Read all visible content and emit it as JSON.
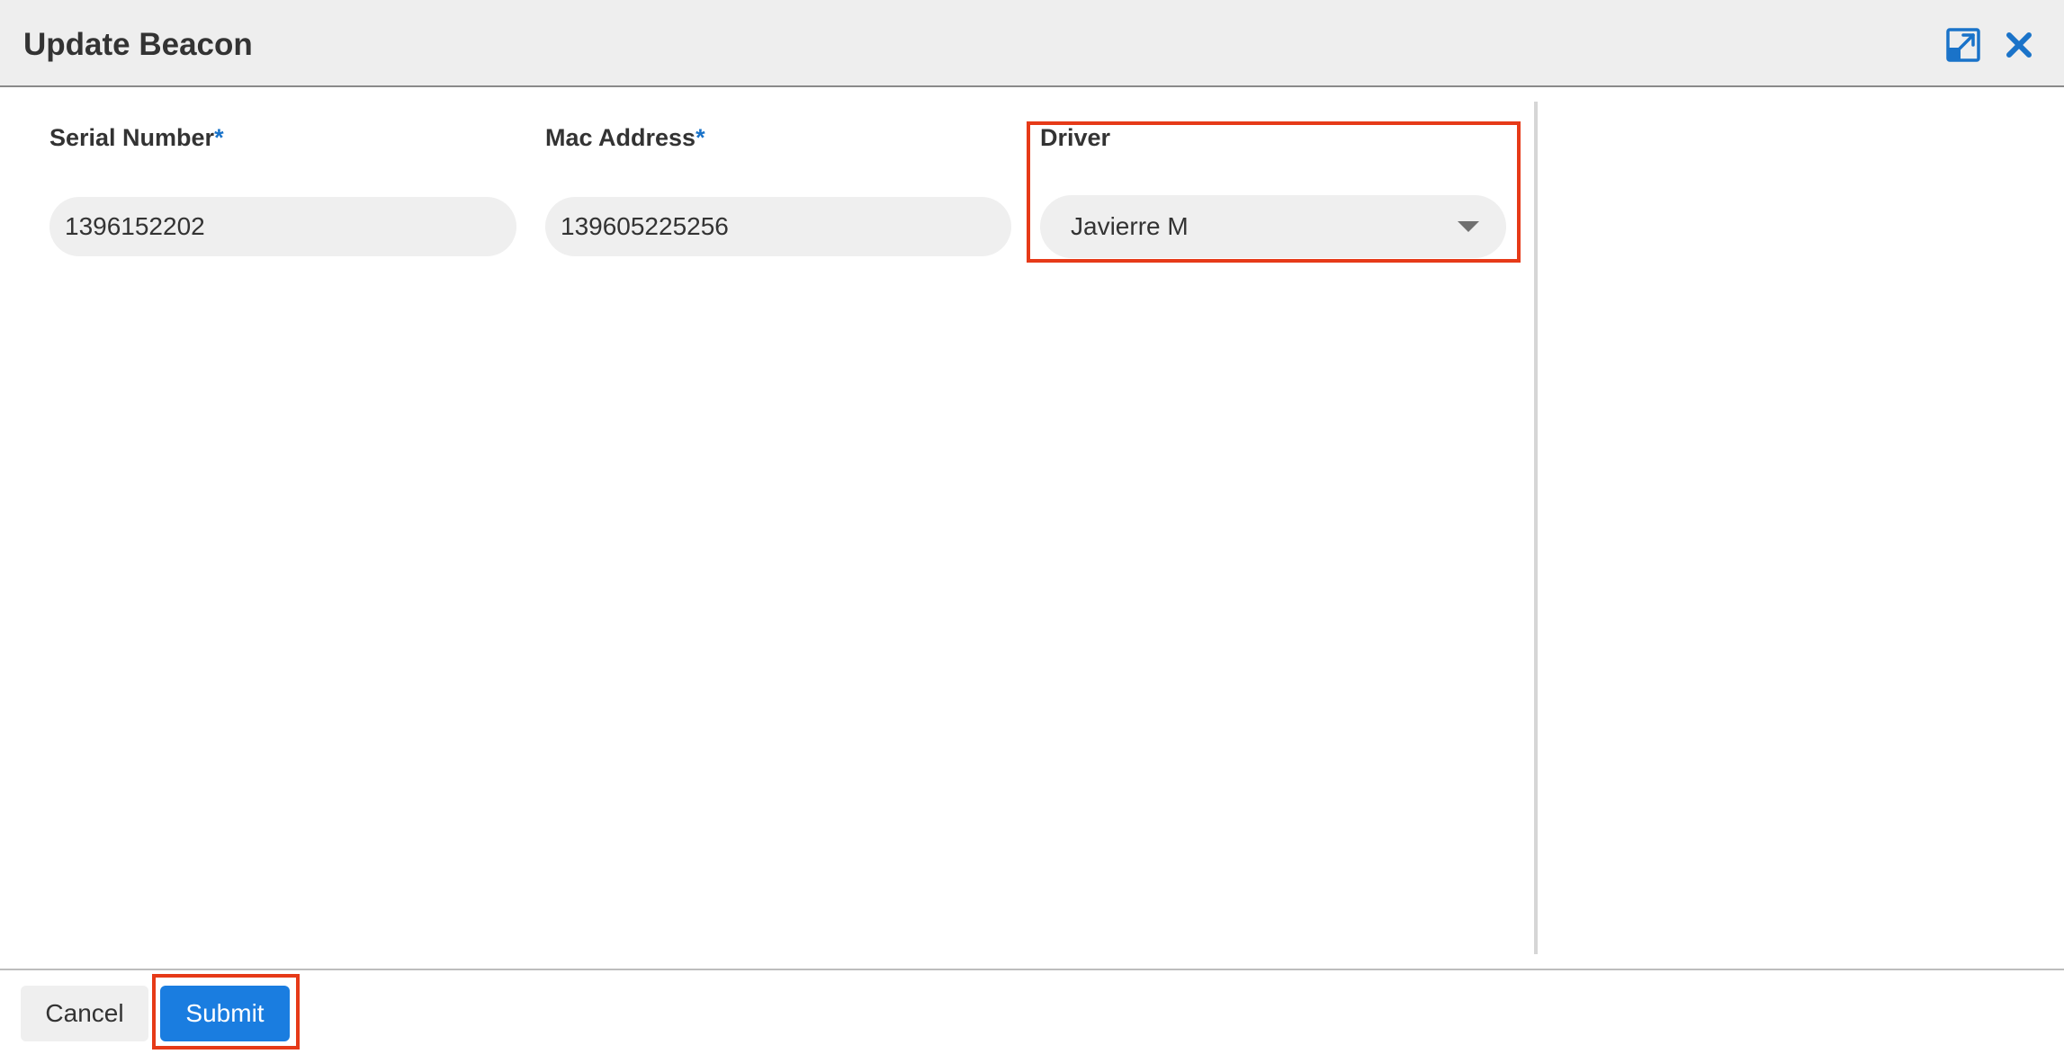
{
  "header": {
    "title": "Update Beacon",
    "expand_icon": "expand-window-icon",
    "close_icon": "close-icon"
  },
  "form": {
    "serial_number": {
      "label": "Serial Number",
      "required_mark": "*",
      "value": "1396152202"
    },
    "mac_address": {
      "label": "Mac Address",
      "required_mark": "*",
      "value": "139605225256"
    },
    "driver": {
      "label": "Driver",
      "selected": "Javierre M",
      "dropdown_icon": "caret-down-icon"
    }
  },
  "footer": {
    "cancel_label": "Cancel",
    "submit_label": "Submit"
  },
  "colors": {
    "accent": "#1a73c9",
    "primary_button": "#1a7de0",
    "highlight": "#e63a18",
    "header_bg": "#eeeeee",
    "input_bg": "#efefef"
  }
}
